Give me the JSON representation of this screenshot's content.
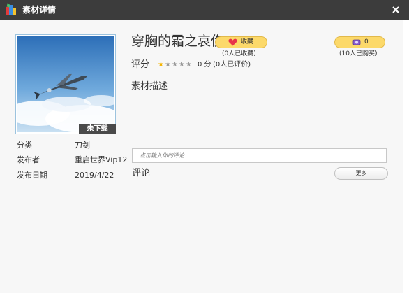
{
  "window": {
    "title": "素材详情"
  },
  "asset": {
    "title": "穿胸的霜之哀伤",
    "download_badge": "未下载"
  },
  "favorite": {
    "button_label": "收藏",
    "count_text": "(0人已收藏)"
  },
  "purchase": {
    "button_label": "0",
    "count_text": "(10人已购买)"
  },
  "rating": {
    "label": "评分",
    "stars_total": 5,
    "stars_filled": 1,
    "score_text": "0 分",
    "count_text": "(0人已评价)"
  },
  "description": {
    "label": "素材描述"
  },
  "meta": [
    {
      "label": "分类",
      "value": "刀剑"
    },
    {
      "label": "发布者",
      "value": "重启世界Vip12"
    },
    {
      "label": "发布日期",
      "value": "2019/4/22"
    }
  ],
  "comments": {
    "input_placeholder": "点击输入你的评论",
    "label": "评论",
    "more_label": "更多"
  },
  "colors": {
    "titlebar": "#3c3c3c",
    "pill_gold": "#fcd96a",
    "heart": "#e8334a",
    "star_on": "#f5b400"
  },
  "icons": {
    "app": "app-logo-icon",
    "close": "close-icon",
    "favorite": "heart-icon",
    "purchase": "coin-icon"
  }
}
